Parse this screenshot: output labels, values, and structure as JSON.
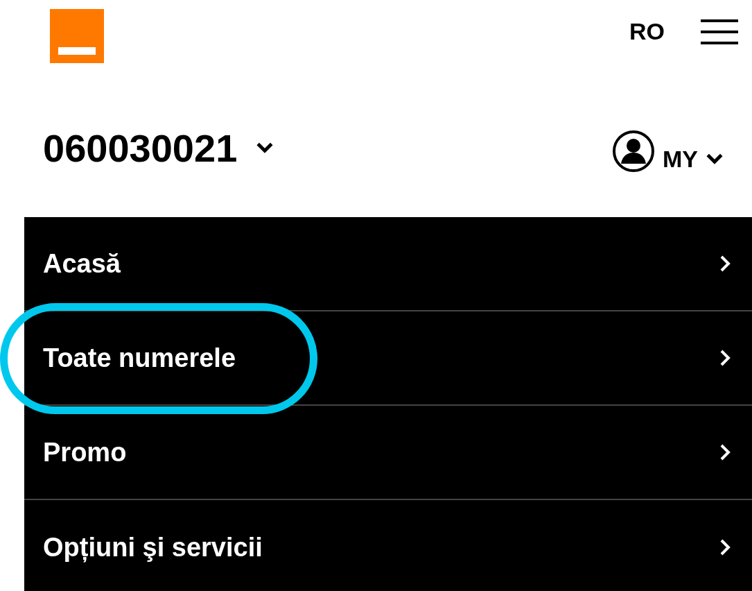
{
  "header": {
    "language": "RO"
  },
  "account": {
    "number": "060030021",
    "user_label": "MY"
  },
  "menu": [
    {
      "label": "Acasă",
      "highlighted": false
    },
    {
      "label": "Toate numerele",
      "highlighted": true
    },
    {
      "label": "Promo",
      "highlighted": false
    },
    {
      "label": "Opțiuni şi servicii",
      "highlighted": false
    }
  ]
}
